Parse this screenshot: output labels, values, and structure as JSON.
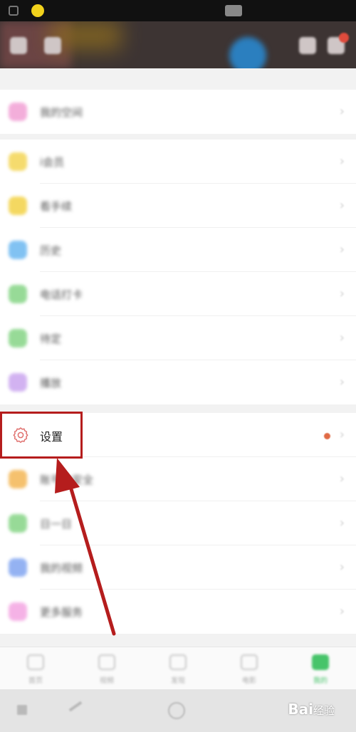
{
  "rows": [
    {
      "label": "我的空间",
      "icon_color": "#f19ad2"
    },
    {
      "label": "i会员",
      "icon_color": "#f3d34a"
    },
    {
      "label": "看手续",
      "icon_color": "#f2cf3a"
    },
    {
      "label": "历史",
      "icon_color": "#62b3f0"
    },
    {
      "label": "电话打卡",
      "icon_color": "#7ed27e"
    },
    {
      "label": "待定",
      "icon_color": "#7ed27e"
    },
    {
      "label": "播放",
      "icon_color": "#c7a0ee"
    },
    {
      "label": "设置",
      "icon_color": "#e0716f"
    },
    {
      "label": "账号与安全",
      "icon_color": "#f3b24a"
    },
    {
      "label": "日一日",
      "icon_color": "#7ed27e"
    },
    {
      "label": "我的视频",
      "icon_color": "#7aa0f0"
    },
    {
      "label": "更多服务",
      "icon_color": "#f3a0e0"
    }
  ],
  "tabs": [
    {
      "label": "首页"
    },
    {
      "label": "视频"
    },
    {
      "label": "发现"
    },
    {
      "label": "电影"
    },
    {
      "label": "我的"
    }
  ],
  "watermark": {
    "brand": "Bai",
    "suffix": "经验"
  },
  "colors": {
    "highlight": "#b51d1d",
    "active_tab": "#47c46a"
  }
}
